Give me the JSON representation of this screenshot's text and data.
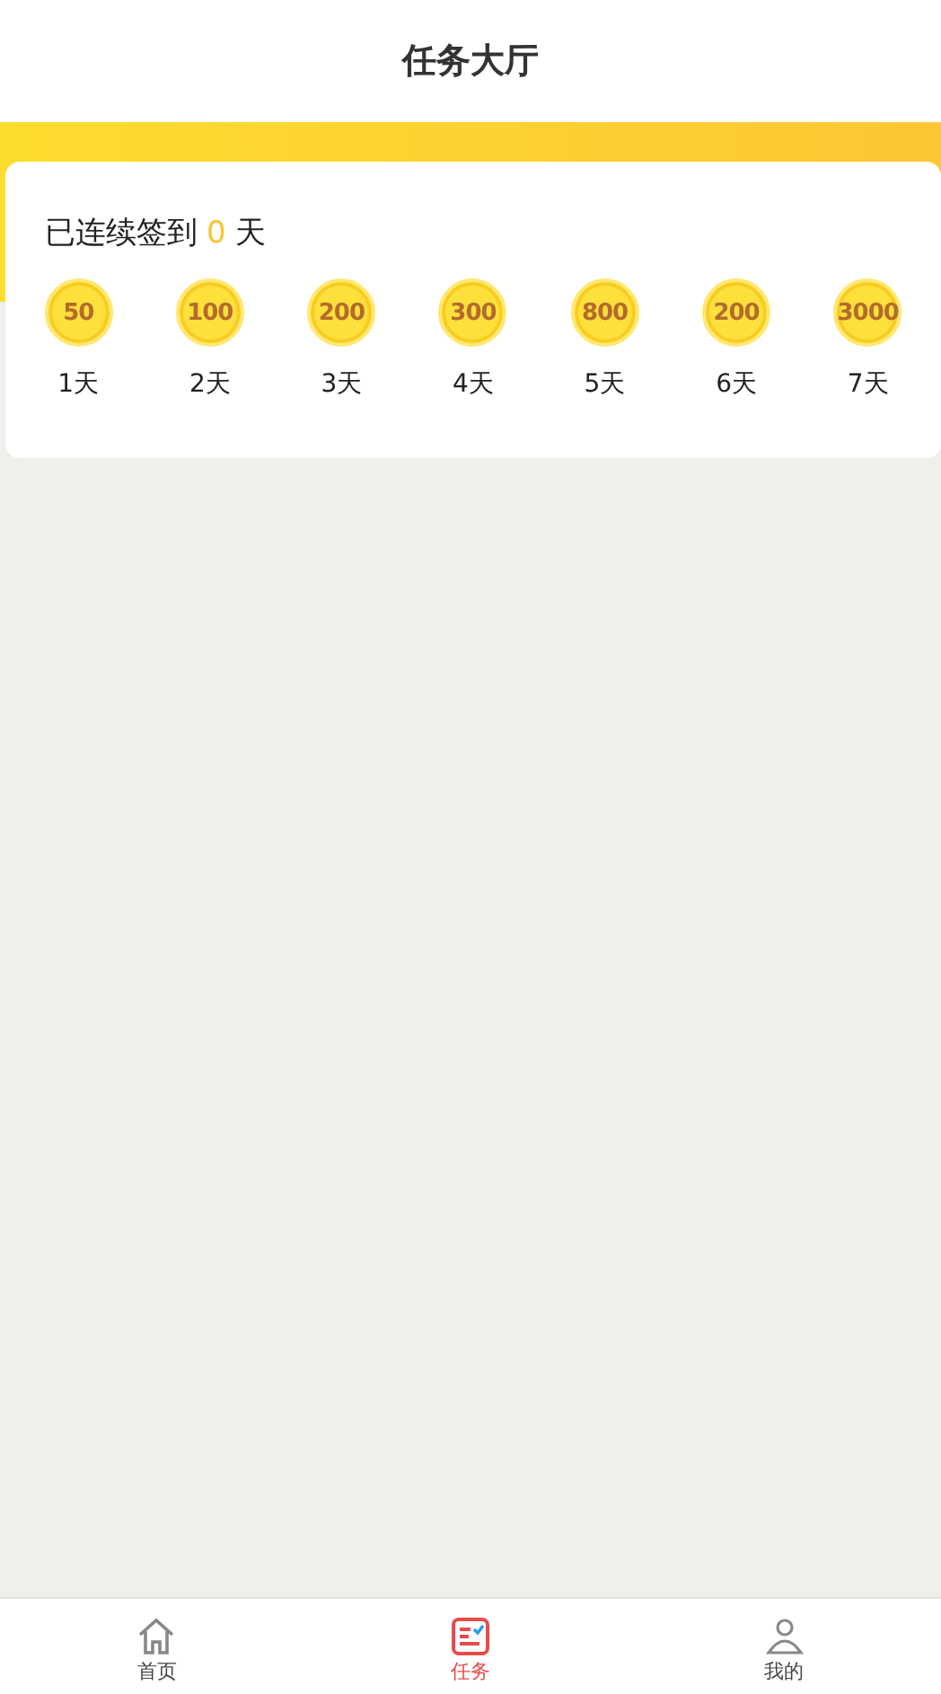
{
  "header": {
    "title": "任务大厅"
  },
  "checkin": {
    "prefix": "已连续签到",
    "count": "0",
    "suffix": "天",
    "days": [
      {
        "coins": "50",
        "label": "1天"
      },
      {
        "coins": "100",
        "label": "2天"
      },
      {
        "coins": "200",
        "label": "3天"
      },
      {
        "coins": "300",
        "label": "4天"
      },
      {
        "coins": "800",
        "label": "5天"
      },
      {
        "coins": "200",
        "label": "6天"
      },
      {
        "coins": "3000",
        "label": "7天"
      }
    ]
  },
  "tab_bar": [
    {
      "kind": "home",
      "label": "首页",
      "selected": false
    },
    {
      "kind": "tasks",
      "label": "任务",
      "selected": true
    },
    {
      "kind": "profile",
      "label": "我的",
      "selected": false
    }
  ]
}
